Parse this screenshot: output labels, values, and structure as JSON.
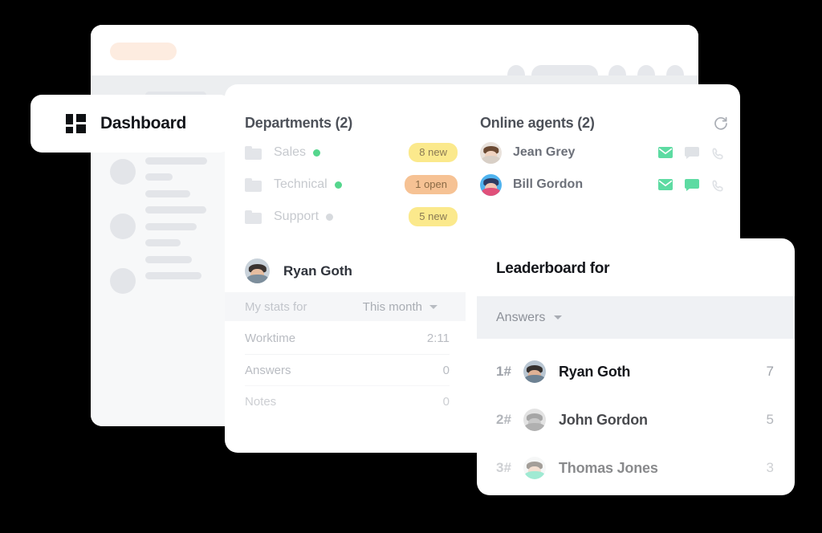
{
  "window": {
    "topbar": {
      "brand_pill_color": "#fdece0",
      "placeholder_color": "#e6e8ec"
    }
  },
  "header": {
    "logo_icon": "grid-logo-icon",
    "title": "Dashboard"
  },
  "departments": {
    "heading": "Departments (2)",
    "items": [
      {
        "folder_icon": "folder-icon",
        "name": "Sales",
        "status": "online",
        "status_color": "#55d68d",
        "badge": "8 new",
        "badge_color": "#fbe98c"
      },
      {
        "folder_icon": "folder-icon",
        "name": "Technical",
        "status": "online",
        "status_color": "#55d68d",
        "badge": "1 open",
        "badge_color": "#f6c294"
      },
      {
        "folder_icon": "folder-icon",
        "name": "Support",
        "status": "offline",
        "status_color": "#d7dade",
        "badge": "5 new",
        "badge_color": "#fbe98c"
      }
    ]
  },
  "online_agents": {
    "heading": "Online agents (2)",
    "refresh_icon": "refresh-icon",
    "items": [
      {
        "name": "Jean Grey",
        "avatar": "avatar-jean-grey",
        "actions": [
          {
            "icon": "mail-icon",
            "active": true
          },
          {
            "icon": "chat-icon",
            "active": false
          },
          {
            "icon": "phone-icon",
            "active": false
          }
        ]
      },
      {
        "name": "Bill Gordon",
        "avatar": "avatar-bill-gordon",
        "actions": [
          {
            "icon": "mail-icon",
            "active": true
          },
          {
            "icon": "chat-icon",
            "active": true
          },
          {
            "icon": "phone-icon",
            "active": false
          }
        ]
      }
    ],
    "active_color": "#5ddba2",
    "inactive_color": "#dfe2e6"
  },
  "my_stats": {
    "user_name": "Ryan Goth",
    "user_avatar": "avatar-ryan-goth",
    "label": "My stats for",
    "period": "This month",
    "period_caret": "chevron-down-icon",
    "rows": [
      {
        "key": "Worktime",
        "value": "2:11"
      },
      {
        "key": "Answers",
        "value": "0"
      },
      {
        "key": "Notes",
        "value": "0"
      }
    ]
  },
  "leaderboard": {
    "title": "Leaderboard for",
    "metric": "Answers",
    "metric_caret": "chevron-down-icon",
    "rows": [
      {
        "rank": "1#",
        "name": "Ryan Goth",
        "score": "7",
        "avatar": "avatar-ryan-goth"
      },
      {
        "rank": "2#",
        "name": "John Gordon",
        "score": "5",
        "avatar": "avatar-john-gordon"
      },
      {
        "rank": "3#",
        "name": "Thomas Jones",
        "score": "3",
        "avatar": "avatar-thomas-jones"
      }
    ]
  }
}
